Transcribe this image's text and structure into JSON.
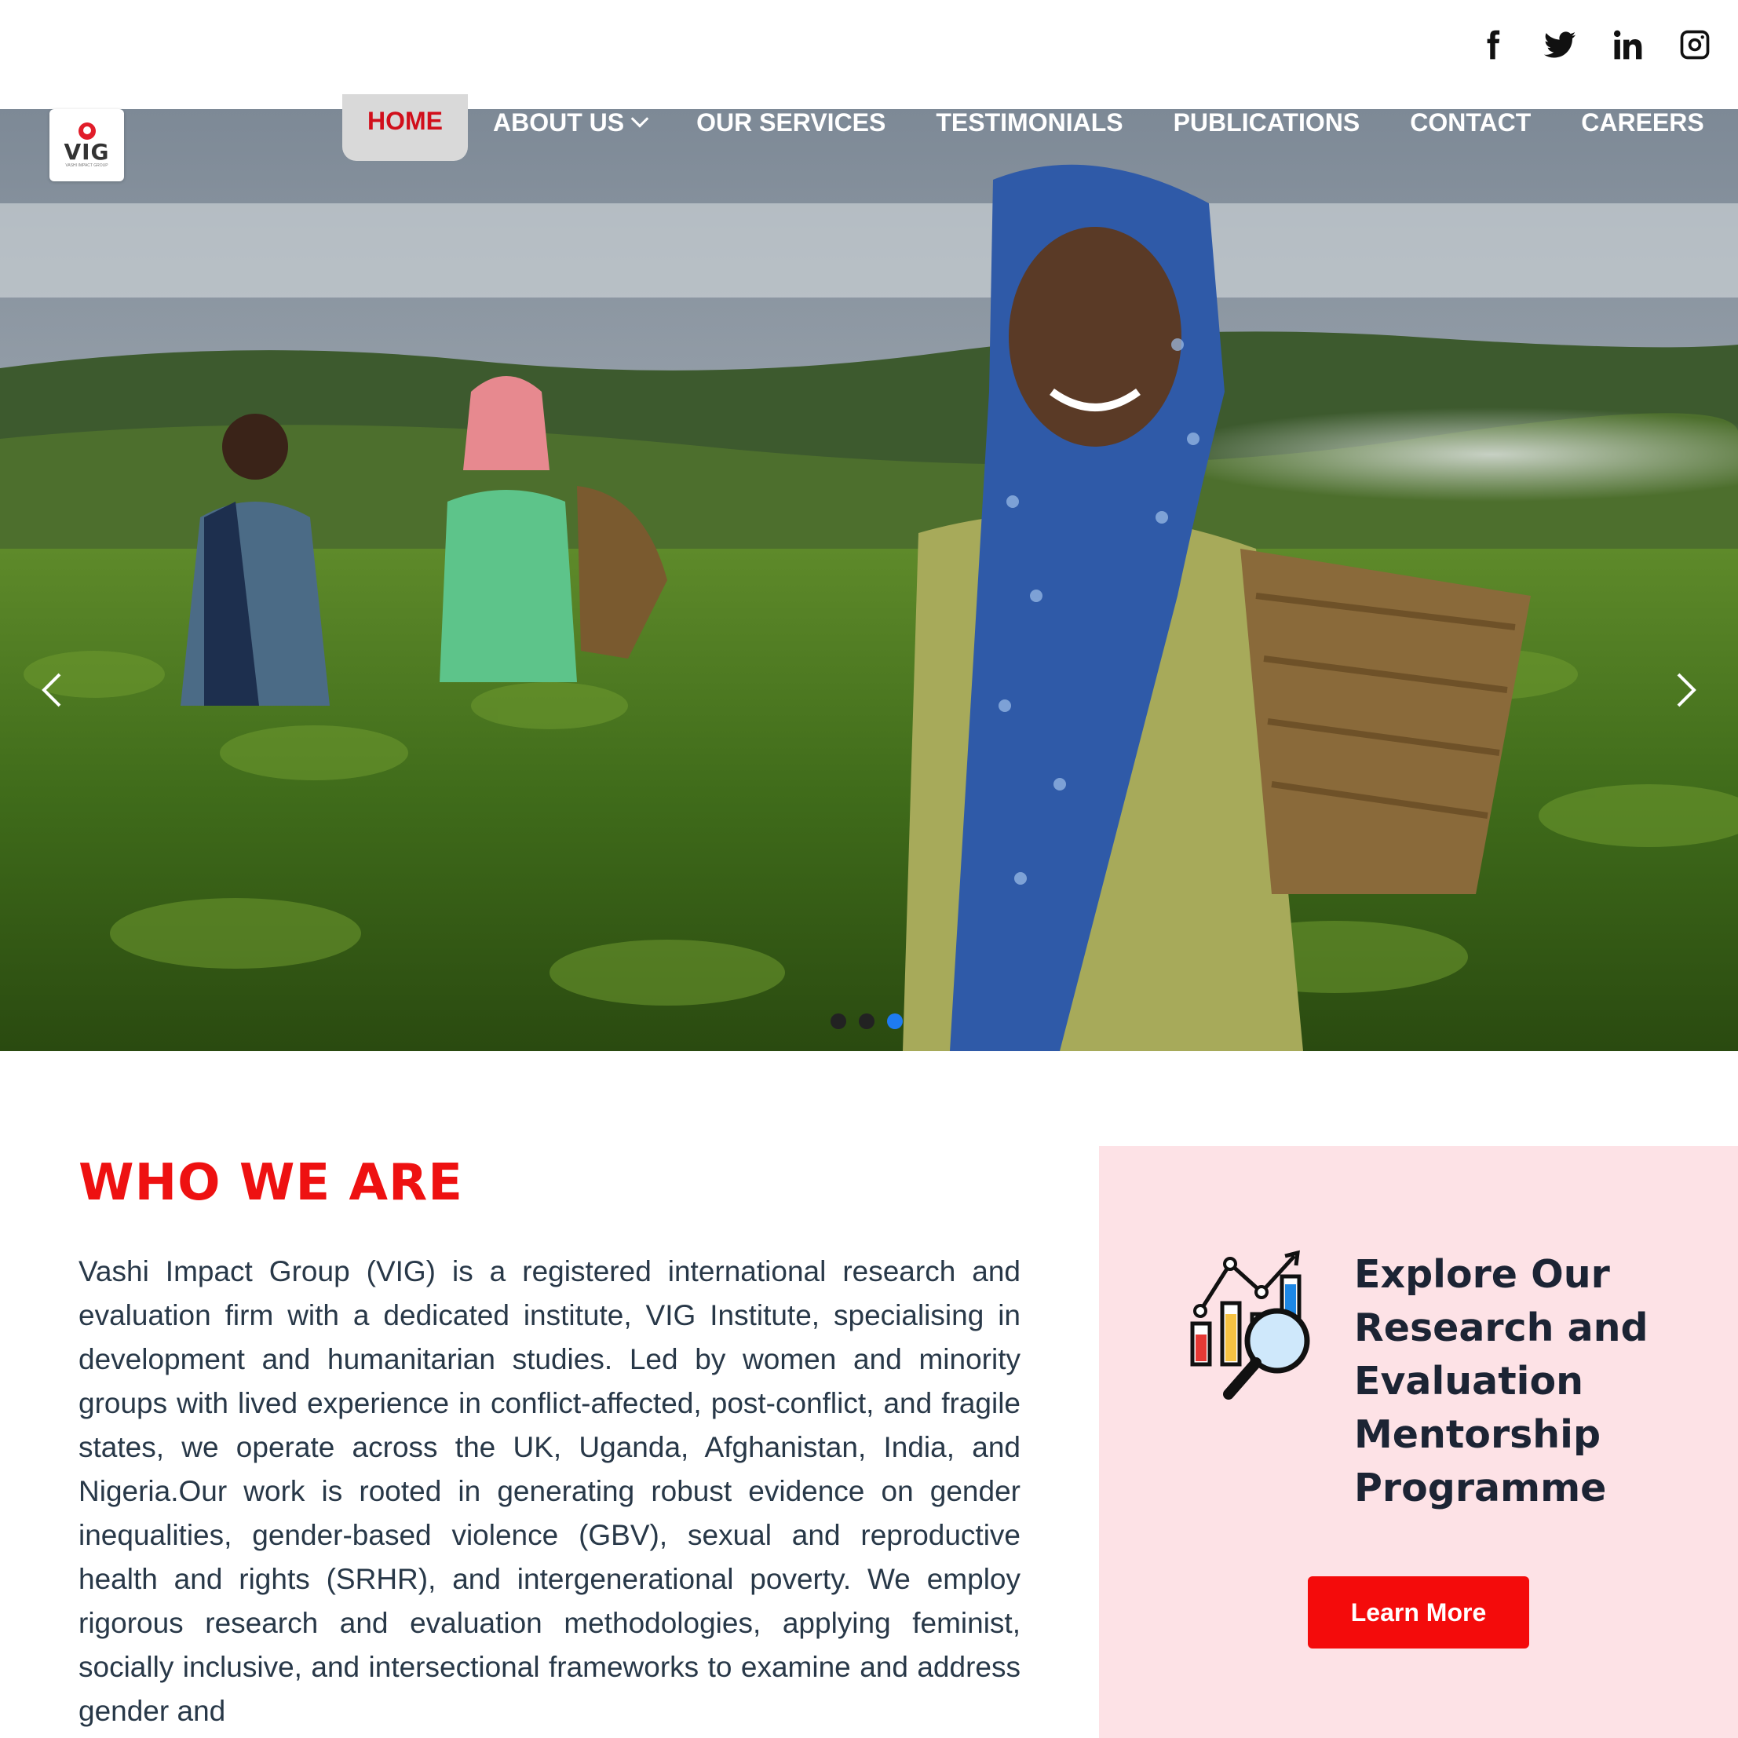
{
  "social": {
    "icons": [
      "facebook-icon",
      "twitter-icon",
      "linkedin-icon",
      "instagram-icon"
    ]
  },
  "logo": {
    "text": "VIG",
    "subtext": "VASHI IMPACT GROUP"
  },
  "nav": {
    "items": [
      {
        "label": "HOME",
        "active": true
      },
      {
        "label": "ABOUT US",
        "dropdown": true
      },
      {
        "label": "OUR SERVICES"
      },
      {
        "label": "TESTIMONIALS"
      },
      {
        "label": "PUBLICATIONS"
      },
      {
        "label": "CONTACT"
      },
      {
        "label": "CAREERS"
      }
    ]
  },
  "carousel": {
    "slides": 3,
    "active_slide": 3,
    "prev_icon": "chevron-left-icon",
    "next_icon": "chevron-right-icon"
  },
  "who": {
    "heading": "WHO WE ARE",
    "body": "Vashi Impact Group (VIG) is a registered international research and evaluation firm with a dedicated institute, VIG Institute, specialising in development and humanitarian studies. Led by women and minority groups with lived experience in conflict-affected, post-conflict, and fragile states, we operate across the UK, Uganda, Afghanistan, India, and Nigeria.Our work is rooted in generating robust evidence on gender inequalities, gender-based violence (GBV), sexual and reproductive health and rights (SRHR), and intergenerational poverty. We employ rigorous research and evaluation methodologies, applying feminist, socially inclusive, and intersectional frameworks to examine and address gender and"
  },
  "card": {
    "title": "Explore Our Research and Evaluation Mentorship Programme",
    "button": "Learn More",
    "icon": "analytics-magnifier-icon"
  },
  "colors": {
    "brand_red": "#ee1111",
    "button_red": "#f40b0b",
    "nav_active_text": "#d10f1b",
    "card_bg": "#fde2e6",
    "dot_active": "#1e7bf2"
  }
}
